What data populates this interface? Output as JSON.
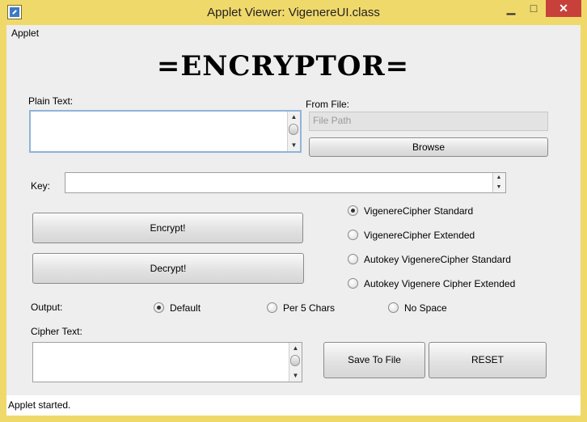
{
  "window": {
    "title": "Applet Viewer: VigenereUI.class",
    "controls": {
      "minimize": "▁",
      "maximize": "□",
      "close": "✕"
    }
  },
  "menu": {
    "items": [
      "Applet"
    ]
  },
  "heading": "=ENCRYPTOR=",
  "plain_text": {
    "label": "Plain Text:",
    "value": ""
  },
  "from_file": {
    "label": "From File:",
    "placeholder": "File Path",
    "browse_label": "Browse"
  },
  "key": {
    "label": "Key:",
    "value": ""
  },
  "actions": {
    "encrypt_label": "Encrypt!",
    "decrypt_label": "Decrypt!"
  },
  "cipher_modes": {
    "selected": 0,
    "options": [
      "VigenereCipher Standard",
      "VigenereCipher Extended",
      "Autokey VigenereCipher Standard",
      "Autokey Vigenere Cipher Extended"
    ]
  },
  "output": {
    "label": "Output:",
    "selected": 0,
    "options": [
      "Default",
      "Per 5 Chars",
      "No Space"
    ]
  },
  "cipher_text": {
    "label": "Cipher Text:",
    "value": ""
  },
  "bottom_buttons": {
    "save_label": "Save To File",
    "reset_label": "RESET"
  },
  "status": {
    "text": "Applet started."
  },
  "colors": {
    "frame": "#f0d96b",
    "close_button": "#c7413a",
    "panel": "#eeeeee",
    "focus_border": "#8fb4d8"
  }
}
